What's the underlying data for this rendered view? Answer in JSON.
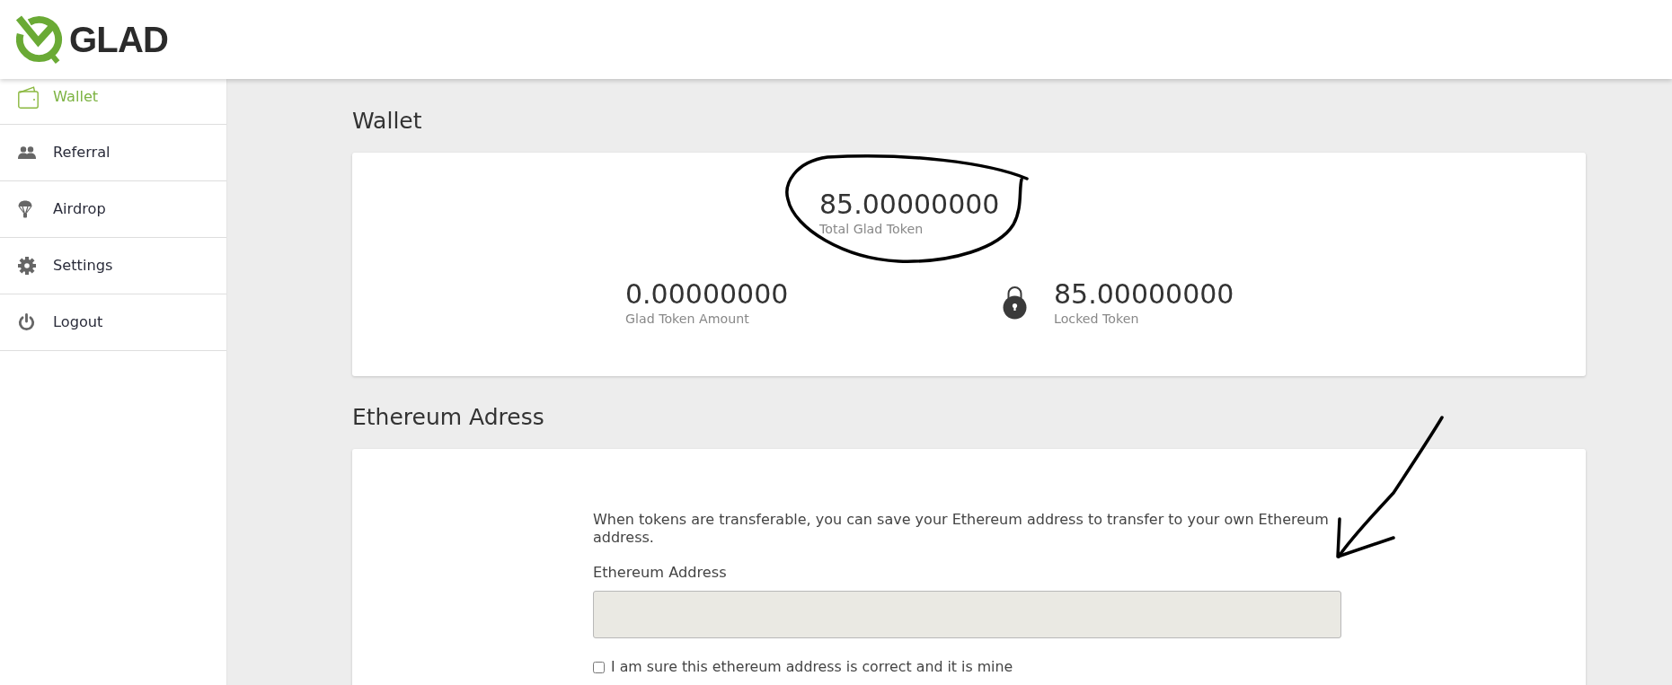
{
  "header": {
    "logo_text": "GLAD"
  },
  "sidebar": {
    "items": [
      {
        "label": "Wallet",
        "selected": true
      },
      {
        "label": "Referral",
        "selected": false
      },
      {
        "label": "Airdrop",
        "selected": false
      },
      {
        "label": "Settings",
        "selected": false
      },
      {
        "label": "Logout",
        "selected": false
      }
    ]
  },
  "wallet_section": {
    "title": "Wallet",
    "total": {
      "value": "85.00000000",
      "label": "Total Glad Token"
    },
    "stats": [
      {
        "kind": "plain",
        "value": "0.00000000",
        "label": "Glad Token Amount"
      },
      {
        "kind": "locked",
        "value": "85.00000000",
        "label": "Locked Token"
      }
    ]
  },
  "ethereum_section": {
    "title": "Ethereum Adress",
    "description": "When tokens are transferable, you can save your Ethereum address to transfer to your own Ethereum address.",
    "field": {
      "label": "Ethereum Address"
    },
    "confirm": {
      "label": "I am sure this ethereum address is correct and it is mine",
      "checked": false
    }
  },
  "annotations": [
    {
      "kind": "ellipse"
    },
    {
      "kind": "arrow"
    }
  ]
}
